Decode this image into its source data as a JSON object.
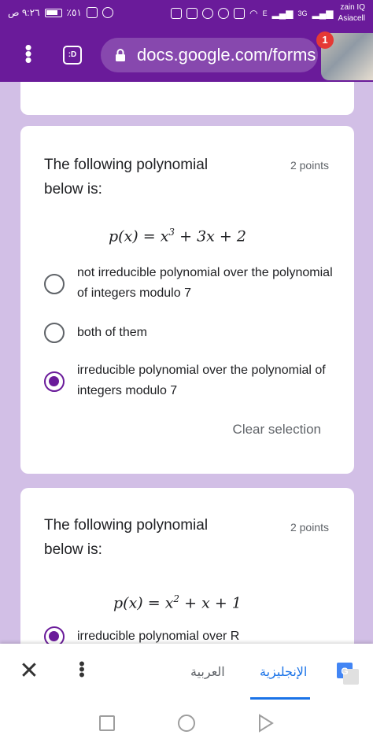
{
  "status_bar": {
    "time": "٩:٢٦ ص",
    "battery": "٪٥١",
    "network_a": "E",
    "network_b": "3G",
    "carrier_1": "zain IQ",
    "carrier_2": "Asiacell"
  },
  "browser": {
    "url": "docs.google.com/forms",
    "tab_icon_label": ":D",
    "notification_count": "1"
  },
  "questions": [
    {
      "title": "The following polynomial below is:",
      "points": "2 points",
      "formula": {
        "lhs": "p(x)",
        "rhs_terms": [
          "x",
          "3",
          "+ 3x + 2"
        ]
      },
      "options": [
        {
          "label": "not irreducible polynomial over the polynomial of integers modulo 7",
          "selected": false
        },
        {
          "label": "both of them",
          "selected": false
        },
        {
          "label": "irreducible polynomial over the polynomial of integers modulo 7",
          "selected": true
        }
      ],
      "clear_label": "Clear selection"
    },
    {
      "title": "The following polynomial below is:",
      "points": "2 points",
      "formula": {
        "lhs": "p(x)",
        "rhs_terms": [
          "x",
          "2",
          "+ x + 1"
        ]
      },
      "options": [
        {
          "label": "irreducible polynomial over R",
          "selected": true
        }
      ]
    }
  ],
  "translate_bar": {
    "source_lang": "العربية",
    "target_lang": "الإنجليزية"
  },
  "colors": {
    "accent": "#6a1b9a",
    "background": "#d2bfe6",
    "link_blue": "#1a73e8"
  }
}
